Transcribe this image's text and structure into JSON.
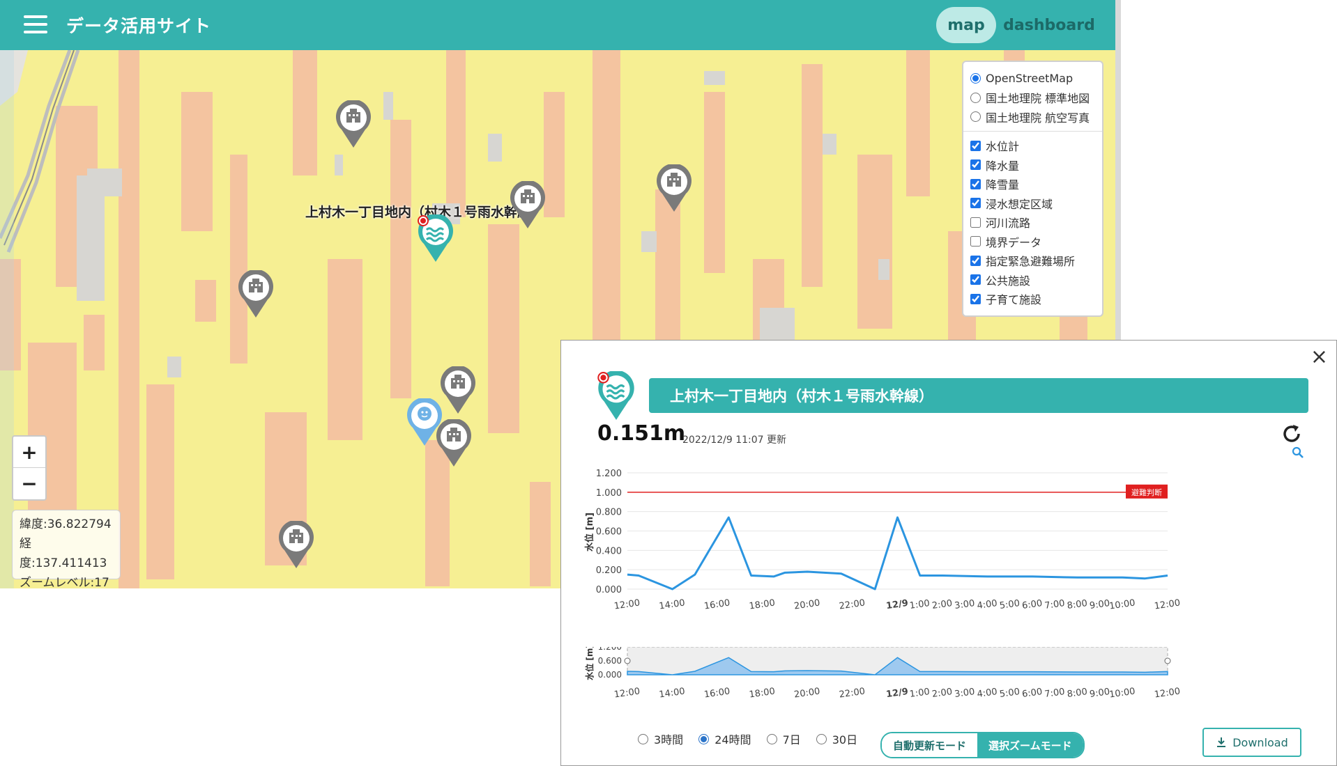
{
  "header": {
    "site_title": "データ活用サイト",
    "nav": {
      "map": "map",
      "dashboard": "dashboard"
    },
    "accent_color": "#35b2ae"
  },
  "map": {
    "place_label": "上村木一丁目地内（村木１号雨水幹線）",
    "zoom_in": "+",
    "zoom_out": "−",
    "coords": {
      "latitude": "緯度:36.822794",
      "longitude": "経度:137.411413",
      "zoom_level": "ズームレベル:17"
    },
    "base_layers": [
      {
        "label": "OpenStreetMap",
        "selected": true
      },
      {
        "label": "国土地理院 標準地図",
        "selected": false
      },
      {
        "label": "国土地理院 航空写真",
        "selected": false
      }
    ],
    "overlays": [
      {
        "label": "水位計",
        "checked": true
      },
      {
        "label": "降水量",
        "checked": true
      },
      {
        "label": "降雪量",
        "checked": true
      },
      {
        "label": "浸水想定区域",
        "checked": true
      },
      {
        "label": "河川流路",
        "checked": false
      },
      {
        "label": "境界データ",
        "checked": false
      },
      {
        "label": "指定緊急避難場所",
        "checked": true
      },
      {
        "label": "公共施設",
        "checked": true
      },
      {
        "label": "子育て施設",
        "checked": true
      }
    ],
    "markers": [
      {
        "type": "public-facility"
      },
      {
        "type": "public-facility"
      },
      {
        "type": "public-facility"
      },
      {
        "type": "public-facility"
      },
      {
        "type": "public-facility"
      },
      {
        "type": "public-facility"
      },
      {
        "type": "public-facility"
      },
      {
        "type": "water-level"
      },
      {
        "type": "childcare"
      }
    ]
  },
  "popup": {
    "close": "×",
    "title": "上村木一丁目地内（村木１号雨水幹線）",
    "reading": "0.151m",
    "updated": "2022/12/9 11:07 更新",
    "ranges": [
      {
        "label": "3時間",
        "selected": false
      },
      {
        "label": "24時間",
        "selected": true
      },
      {
        "label": "7日",
        "selected": false
      },
      {
        "label": "30日",
        "selected": false
      }
    ],
    "modes": [
      {
        "label": "自動更新モード",
        "active": false
      },
      {
        "label": "選択ズームモード",
        "active": true
      }
    ],
    "download": "Download"
  },
  "chart_data": [
    {
      "type": "line",
      "ylabel": "水位 [m]",
      "ylim": [
        0,
        1.2
      ],
      "yticks": [
        "0.000",
        "0.200",
        "0.400",
        "0.600",
        "0.800",
        "1.000",
        "1.200"
      ],
      "xticks": [
        "12:00",
        "14:00",
        "16:00",
        "18:00",
        "20:00",
        "22:00",
        "12/9",
        "1:00",
        "2:00",
        "3:00",
        "4:00",
        "5:00",
        "6:00",
        "7:00",
        "8:00",
        "9:00",
        "10:00",
        "12:00"
      ],
      "threshold": {
        "value": 1.0,
        "label": "避難判断",
        "color": "#e02020"
      },
      "line_color": "#2b95e0",
      "series": [
        {
          "x": [
            0,
            0.5,
            2,
            3,
            4.5,
            5.5,
            6.5,
            7,
            8,
            9.5,
            11,
            12,
            13,
            14,
            16,
            18,
            20,
            22,
            23,
            24
          ],
          "values": [
            0.15,
            0.14,
            0.0,
            0.15,
            0.74,
            0.14,
            0.13,
            0.17,
            0.18,
            0.16,
            0.0,
            0.74,
            0.14,
            0.14,
            0.13,
            0.13,
            0.12,
            0.12,
            0.11,
            0.14
          ]
        }
      ]
    },
    {
      "type": "area",
      "ylabel": "水位 [m]",
      "ylim": [
        0,
        1.2
      ],
      "yticks": [
        "0.000",
        "0.600",
        "1.200"
      ],
      "xticks": [
        "12:00",
        "14:00",
        "16:00",
        "18:00",
        "20:00",
        "22:00",
        "12/9",
        "1:00",
        "2:00",
        "3:00",
        "4:00",
        "5:00",
        "6:00",
        "7:00",
        "8:00",
        "9:00",
        "10:00",
        "12:00"
      ]
    }
  ]
}
